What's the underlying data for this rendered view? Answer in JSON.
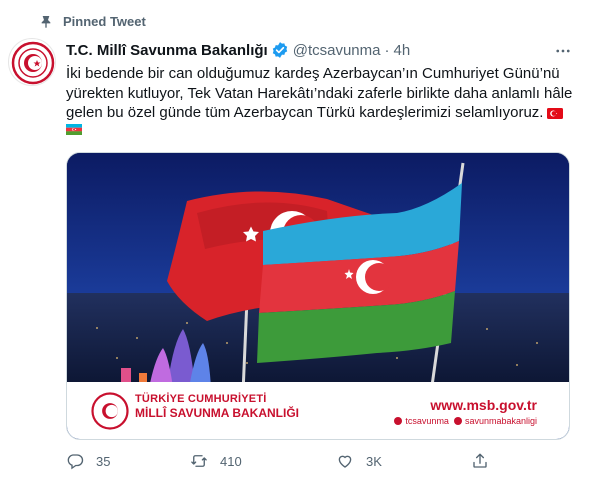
{
  "pinned": {
    "label": "Pinned Tweet",
    "icon": "pin-icon"
  },
  "author": {
    "display_name": "T.C. Millî Savunma Bakanlığı",
    "handle": "@tcsavunma",
    "separator": "·",
    "time": "4h",
    "verified_icon": "verified-badge-icon"
  },
  "tweet": {
    "text": "İki bedende bir can olduğumuz kardeş Azerbaycan’ın Cumhuriyet Günü’nü yürekten kutluyor, Tek Vatan Harekâtı’ndaki zaferle birlikte daha anlamlı hâle gelen bu özel günde tüm Azerbaycan Türkü kardeşlerimizi selamlıyoruz.",
    "emojis": [
      "turkey-flag-emoji",
      "azerbaijan-flag-emoji"
    ]
  },
  "media": {
    "banner_org_line1": "TÜRKİYE CUMHURİYETİ",
    "banner_org_line2": "MİLLÎ SAVUNMA BAKANLIĞI",
    "banner_url": "www.msb.gov.tr",
    "banner_social_1": "tcsavunma",
    "banner_social_2": "savunmabakanligi"
  },
  "actions": {
    "reply_count": "35",
    "retweet_count": "410",
    "like_count": "3K"
  },
  "colors": {
    "accent": "#1d9bf0",
    "muted": "#536471",
    "turkey_red": "#e30a17",
    "az_blue": "#00b5e2",
    "az_red": "#ef3340",
    "az_green": "#509e2f"
  }
}
